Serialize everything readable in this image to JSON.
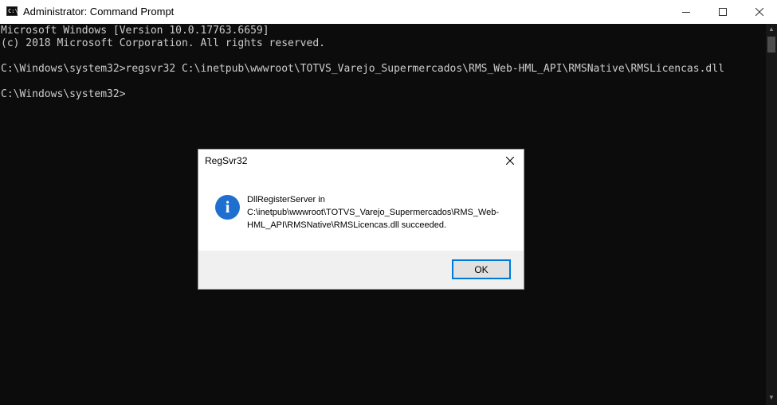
{
  "window": {
    "title": "Administrator: Command Prompt",
    "icon": "cmd-icon",
    "icon_glyph": "C:\\"
  },
  "console": {
    "lines": [
      "Microsoft Windows [Version 10.0.17763.6659]",
      "(c) 2018 Microsoft Corporation. All rights reserved.",
      "",
      "C:\\Windows\\system32>regsvr32 C:\\inetpub\\wwwroot\\TOTVS_Varejo_Supermercados\\RMS_Web-HML_API\\RMSNative\\RMSLicencas.dll",
      "",
      "C:\\Windows\\system32>"
    ]
  },
  "dialog": {
    "title": "RegSvr32",
    "icon": "info-icon",
    "icon_glyph": "i",
    "message_lines": [
      "DllRegisterServer in",
      "C:\\inetpub\\wwwroot\\TOTVS_Varejo_Supermercados\\RMS_Web-",
      "HML_API\\RMSNative\\RMSLicencas.dll succeeded."
    ],
    "ok_label": "OK"
  },
  "colors": {
    "console_bg": "#0c0c0c",
    "console_text": "#cccccc",
    "accent": "#0078d7",
    "info_icon": "#1e6fd0"
  }
}
